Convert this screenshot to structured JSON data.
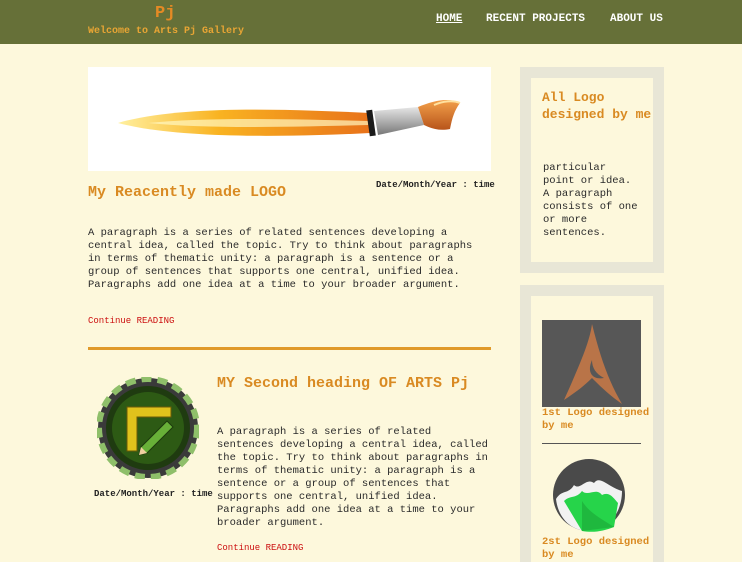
{
  "brand": {
    "title": "Pj",
    "subtitle": "Welcome to Arts Pj Gallery"
  },
  "nav": {
    "home": "HOME",
    "recent": "RECENT PROJECTS",
    "about": "ABOUT US"
  },
  "post1": {
    "date": "Date/Month/Year : time",
    "title": "My Reacently made LOGO",
    "body": "A paragraph is a series of related sentences developing a central idea, called the topic. Try to think about paragraphs in terms of thematic unity: a paragraph is a sentence or a group of sentences that supports one central, unified idea. Paragraphs add one idea at a time to your broader argument.",
    "more": "Continue READING"
  },
  "post2": {
    "date": "Date/Month/Year : time",
    "title": "MY Second heading OF ARTS Pj",
    "body": "A paragraph is a series of related sentences developing a central idea, called the topic. Try to think about paragraphs in terms of thematic unity: a paragraph is a sentence or a group of sentences that supports one central, unified idea. Paragraphs add one idea at a time to your broader argument.",
    "more": "Continue READING"
  },
  "sidebar": {
    "heading": "All Logo designed by me",
    "text": "particular point or idea. A paragraph consists of one or more sentences.",
    "logo1_caption": "1st Logo designed by me",
    "logo2_caption": "2st Logo designed by me"
  },
  "colors": {
    "topbar": "#667038",
    "accent": "#d98a22",
    "background": "#fdf8dc",
    "link": "#cc1111"
  },
  "icons": {
    "post1_image": "paintbrush-icon",
    "post2_image": "ruler-pencil-badge-icon",
    "logo1": "letter-a-logo-icon",
    "logo2": "mountain-circle-logo-icon"
  }
}
